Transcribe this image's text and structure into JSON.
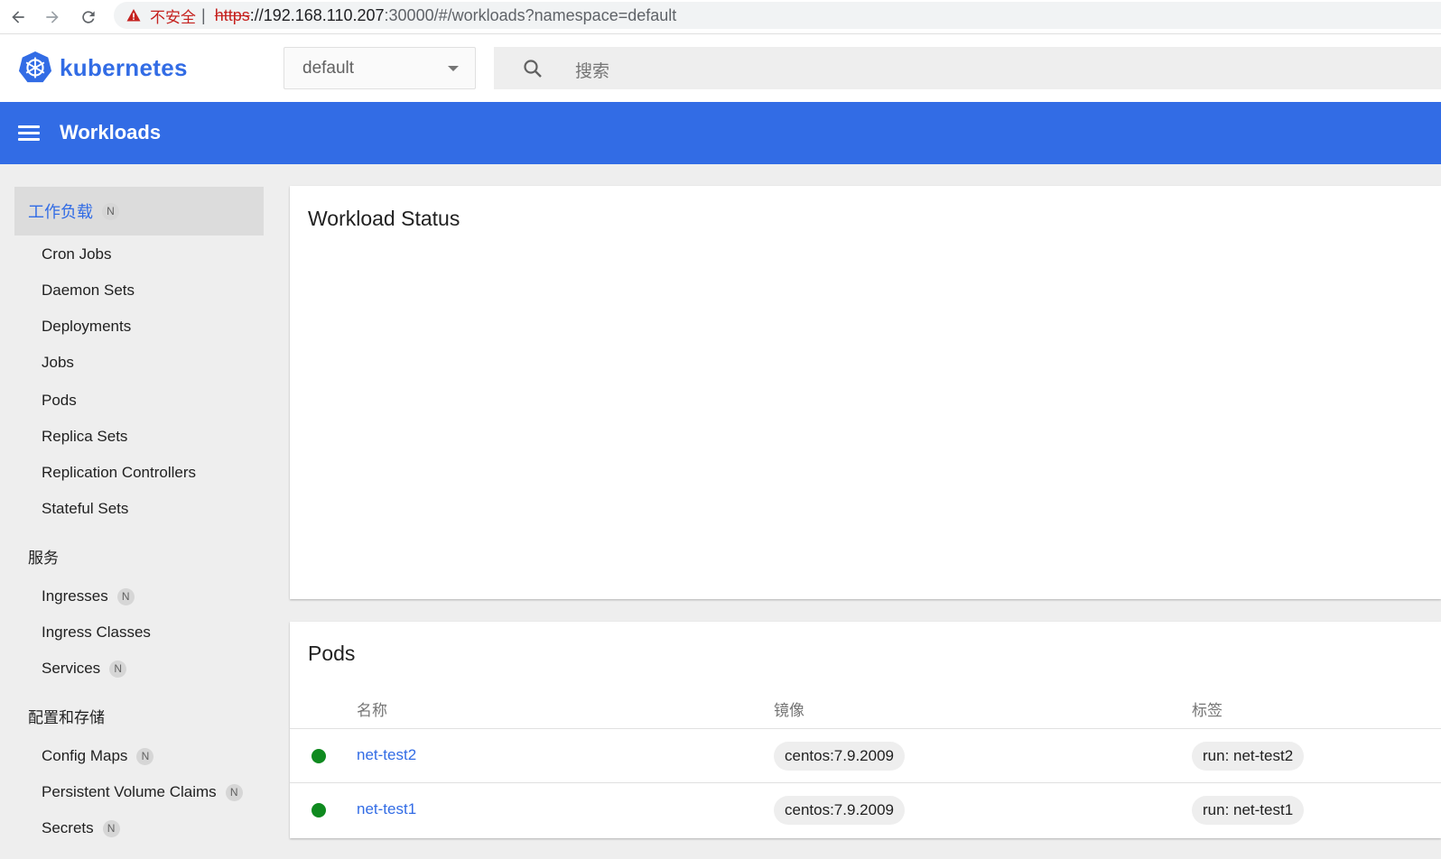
{
  "browser": {
    "insecure_label": "不安全",
    "separator": "|",
    "url_scheme": "https",
    "url_host": "://192.168.110.207",
    "url_rest": ":30000/#/workloads?namespace=default"
  },
  "header": {
    "logo_text": "kubernetes",
    "namespace": "default",
    "search_placeholder": "搜索"
  },
  "toolbar": {
    "title": "Workloads"
  },
  "sidebar": {
    "workloads_section": {
      "label": "工作负载",
      "badge": "N"
    },
    "workload_items": [
      "Cron Jobs",
      "Daemon Sets",
      "Deployments",
      "Jobs",
      "Pods",
      "Replica Sets",
      "Replication Controllers",
      "Stateful Sets"
    ],
    "services_heading": "服务",
    "service_items": [
      {
        "label": "Ingresses",
        "badge": "N"
      },
      {
        "label": "Ingress Classes",
        "badge": ""
      },
      {
        "label": "Services",
        "badge": "N"
      }
    ],
    "config_heading": "配置和存储",
    "config_items": [
      {
        "label": "Config Maps",
        "badge": "N"
      },
      {
        "label": "Persistent Volume Claims",
        "badge": "N"
      },
      {
        "label": "Secrets",
        "badge": "N"
      }
    ]
  },
  "workload_status": {
    "title": "Workload Status"
  },
  "pods": {
    "title": "Pods",
    "columns": [
      "名称",
      "镜像",
      "标签"
    ],
    "rows": [
      {
        "name": "net-test2",
        "image": "centos:7.9.2009",
        "label": "run: net-test2",
        "status": "running"
      },
      {
        "name": "net-test1",
        "image": "centos:7.9.2009",
        "label": "run: net-test1",
        "status": "running"
      }
    ]
  },
  "colors": {
    "accent": "#326ce5",
    "status_running": "#0f8a1f",
    "insecure": "#c5221f"
  }
}
